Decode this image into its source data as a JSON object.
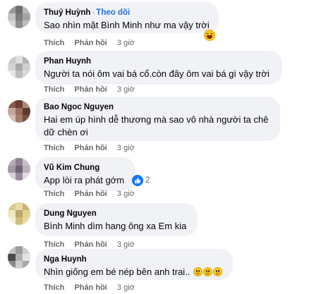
{
  "comments": [
    {
      "author": "Thuỷ Huỳnh",
      "follow": "Theo dõi",
      "text": [
        "Sao nhìn mặt Bình Minh như ma vậy trời"
      ],
      "like": "Thích",
      "reply": "Phản hồi",
      "time": "3 giờ"
    },
    {
      "author": "Phan Huynh",
      "text": [
        "Người ta nói ôm vai bá cổ.còn đây ôm vai bá gì vậy trời"
      ],
      "like": "Thích",
      "reply": "Phản hồi",
      "time": "3 giờ"
    },
    {
      "author": "Bao Ngoc Nguyen",
      "text": [
        "Hai em úp hình dễ thương mà sao vô nhà người ta chê",
        "dữ chèn ơi"
      ],
      "like": "Thích",
      "reply": "Phản hồi",
      "time": "3 giờ"
    },
    {
      "author": "Vũ Kim Chung",
      "text": [
        "App lòi ra phát gớm"
      ],
      "reaction_count": "2",
      "like": "Thích",
      "reply": "Phản hồi",
      "time": "3 giờ"
    },
    {
      "author": "Dung Nguyen",
      "text": [
        "Bình Minh dìm hang ông xa Em kia"
      ],
      "like": "Thích",
      "reply": "Phản hồi",
      "time": "3 giờ"
    },
    {
      "author": "Nga Huynh",
      "text": [
        "Nhìn giống em bé nép bên anh trai.."
      ],
      "like": "Thích",
      "reply": "Phản hồi",
      "time": "3 giờ"
    }
  ],
  "colors": {
    "bubble": "#f0f2f5",
    "follow": "#216fdb",
    "meta": "#65676b",
    "like_icon": "#1877f2"
  },
  "icons": [
    "laughing-emoji-icon",
    "like-thumb-icon",
    "smile-emoji-icon"
  ]
}
